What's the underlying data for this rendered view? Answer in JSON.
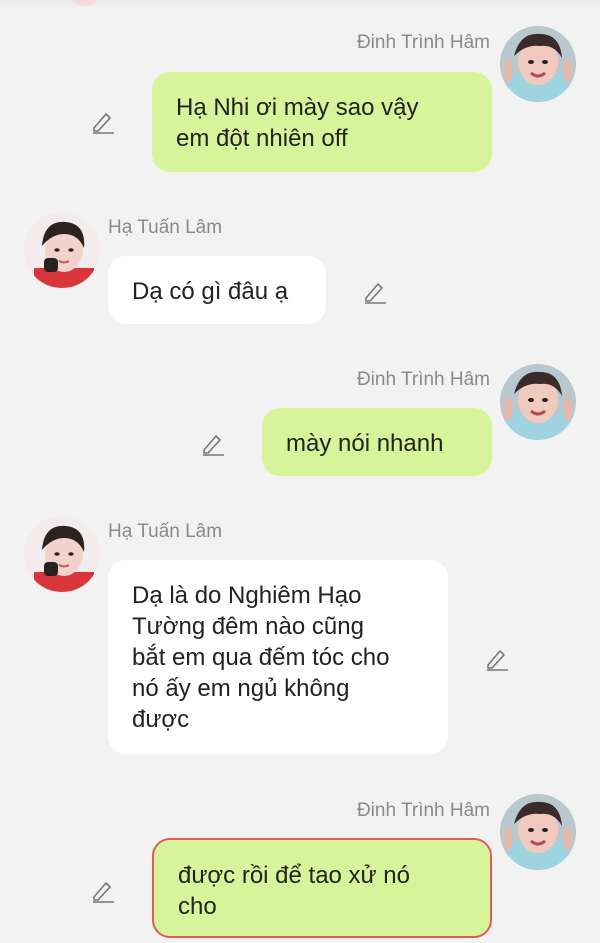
{
  "messages": [
    {
      "sender": "Đinh Trình Hâm",
      "side": "right",
      "text": "Hạ Nhi ơi mày sao vậy\nem đột nhiên off"
    },
    {
      "sender": "Hạ Tuấn Lâm",
      "side": "left",
      "text": "Dạ có gì đâu ạ"
    },
    {
      "sender": "Đinh Trình Hâm",
      "side": "right",
      "text": "mày nói nhanh"
    },
    {
      "sender": "Hạ Tuấn Lâm",
      "side": "left",
      "text": "Dạ là do Nghiêm Hạo\nTường đêm nào cũng\nbắt em qua đếm tóc cho\nnó ấy em ngủ không\nđược"
    },
    {
      "sender": "Đinh Trình Hâm",
      "side": "right",
      "text": "được rồi để tao xử nó\ncho",
      "selected": true
    }
  ],
  "colors": {
    "my_bubble": "#d8f49a",
    "their_bubble": "#ffffff",
    "selected_border": "#e25b53",
    "background": "#f2f2f2",
    "sender_name": "#8a8a8a"
  },
  "icons": {
    "edit": "pencil-icon",
    "avatar_right": "avatar-dinh-trinh-ham",
    "avatar_left": "avatar-ha-tuan-lam"
  }
}
